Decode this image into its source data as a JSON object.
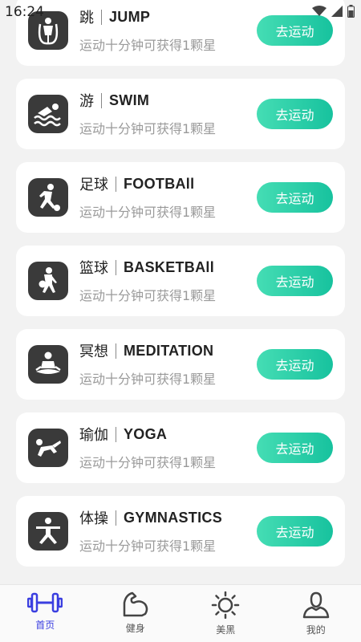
{
  "status_bar": {
    "time": "16:24",
    "icons": [
      "wifi-icon",
      "signal-icon",
      "battery-icon"
    ]
  },
  "sports": [
    {
      "cn": "跳",
      "en": "JUMP",
      "desc": "运动十分钟可获得1颗星",
      "button": "去运动",
      "icon": "jump-rope-icon"
    },
    {
      "cn": "游",
      "en": "SWIM",
      "desc": "运动十分钟可获得1颗星",
      "button": "去运动",
      "icon": "swim-icon"
    },
    {
      "cn": "足球",
      "en": "FOOTBAll",
      "desc": "运动十分钟可获得1颗星",
      "button": "去运动",
      "icon": "football-icon"
    },
    {
      "cn": "篮球",
      "en": "BASKETBAll",
      "desc": "运动十分钟可获得1颗星",
      "button": "去运动",
      "icon": "basketball-icon"
    },
    {
      "cn": "冥想",
      "en": "MEDITATION",
      "desc": "运动十分钟可获得1颗星",
      "button": "去运动",
      "icon": "meditation-icon"
    },
    {
      "cn": "瑜伽",
      "en": "YOGA",
      "desc": "运动十分钟可获得1颗星",
      "button": "去运动",
      "icon": "yoga-icon"
    },
    {
      "cn": "体操",
      "en": "GYMNASTICS",
      "desc": "运动十分钟可获得1颗星",
      "button": "去运动",
      "icon": "gymnastics-icon"
    }
  ],
  "tabs": [
    {
      "label": "首页",
      "icon": "dumbbell-icon",
      "active": true
    },
    {
      "label": "健身",
      "icon": "muscle-arm-icon",
      "active": false
    },
    {
      "label": "美黑",
      "icon": "sun-icon",
      "active": false
    },
    {
      "label": "我的",
      "icon": "user-icon",
      "active": false
    }
  ],
  "colors": {
    "accent": "#3a3ee0",
    "button_start": "#45ddb4",
    "button_end": "#17c29e",
    "icon_bg": "#3a3a3a"
  }
}
